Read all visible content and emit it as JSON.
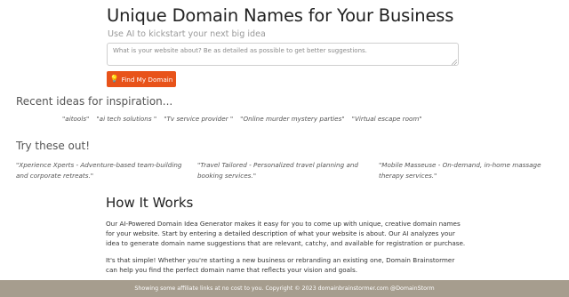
{
  "header": {
    "title": "Unique Domain Names for Your Business",
    "subtitle": "Use AI to kickstart your next big idea"
  },
  "search": {
    "placeholder": "What is your website about? Be as detailed as possible to get better suggestions.",
    "value": ""
  },
  "find_button": {
    "icon": "lightbulb-icon",
    "label": "Find My Domain",
    "color": "#e8531a"
  },
  "recent": {
    "heading": "Recent ideas for inspiration...",
    "items": [
      "\"aitools\"",
      "\"ai tech solutions \"",
      "\"Tv service provider \"",
      "\"Online murder mystery parties\"",
      "\"Virtual escape room\""
    ]
  },
  "try": {
    "heading": "Try these out!",
    "items": [
      "\"Xperience Xperts - Adventure-based team-building and corporate retreats.\"",
      "\"Travel Tailored - Personalized travel planning and booking services.\"",
      "\"Mobile Masseuse - On-demand, in-home massage therapy services.\""
    ]
  },
  "how": {
    "heading": "How It Works",
    "paragraphs": [
      "Our AI-Powered Domain Idea Generator makes it easy for you to come up with unique, creative domain names for your website. Start by entering a detailed description of what your website is about. Our AI analyzes your idea to generate domain name suggestions that are relevant, catchy, and available for registration or purchase.",
      "It's that simple! Whether you're starting a new business or rebranding an existing one, Domain Brainstormer can help you find the perfect domain name that reflects your vision and goals."
    ]
  },
  "footer": {
    "text": "Showing some affiliate links at no cost to you. Copyright © 2023 domainbrainstormer.com @DomainStorm",
    "background": "#a69d8e"
  }
}
